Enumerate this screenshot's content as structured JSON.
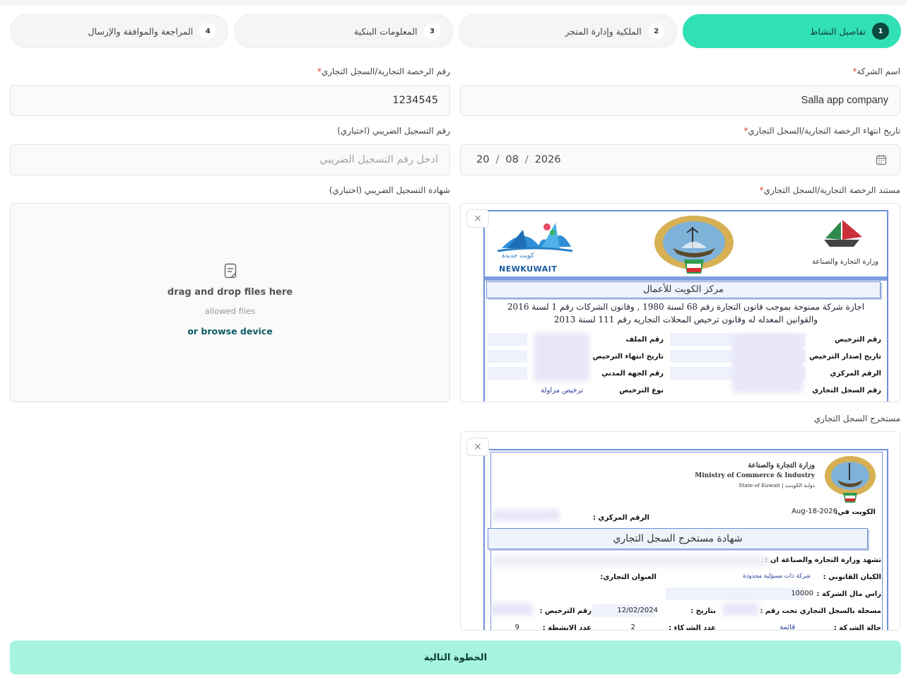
{
  "steps": [
    {
      "num": "1",
      "label": "تفاصيل النشاط"
    },
    {
      "num": "2",
      "label": "الملكية وإدارة المتجر"
    },
    {
      "num": "3",
      "label": "المعلومات البنكية"
    },
    {
      "num": "4",
      "label": "المراجعة والموافقة والإرسال"
    }
  ],
  "form": {
    "company_name_label": "اسم الشركة",
    "company_name_value": "Salla app company",
    "license_number_label": "رقم الرخصة التجارية/السجل التجاري",
    "license_number_value": "1234545",
    "license_expiry_label": "تاريخ انتهاء الرخصة التجارية/السجل التجاري",
    "license_expiry_day": "20",
    "license_expiry_month": "08",
    "license_expiry_year": "2026",
    "tax_number_label": "رقم التسجيل الضريبي (اختياري)",
    "tax_number_placeholder": "أدخل رقم التسجيل الضريبي",
    "license_doc_label": "مستند الرخصة التجارية/السجل التجاري",
    "tax_certificate_label": "شهادة التسجيل الضريبي (اختياري)",
    "commercial_extract_label": "مستخرج السجل التجاري",
    "required_mark": "*",
    "date_separator": "/"
  },
  "upload": {
    "drag_text": "drag and drop files here",
    "allowed_text": "allowed files",
    "browse_text": "or browse device",
    "close_glyph": "×"
  },
  "doc1": {
    "newkuwait": "NEWKUWAIT",
    "newkuwait_ar": "كويت جديدة",
    "ministry_ar": "وزارة التجارة والصناعة",
    "center_title": "مركز الكويت للأعمال",
    "line1": "اجازة شركة ممنوحة بموجب قانون التجارة رقم 68 لسنة 1980 , وقانون الشركات رقم 1 لسنة 2016",
    "line2": "والقوانين المعدله له وقانون ترخيص المحلات التجاريه رقم 111 لسنة 2013",
    "right_rows": [
      "رقم الترخيص",
      "تاريخ إصدار الترخيص",
      "الرقم المركزي",
      "رقم السجل التجاري"
    ],
    "mid_rows": [
      "رقم الملف",
      "تاريخ انتهاء الترخيص",
      "رقم الجهة المدني",
      "نوع الترخيص"
    ],
    "license_type_value": "ترخيص مزاولة"
  },
  "doc2": {
    "ministry_ar": "وزارة التجارة والصناعة",
    "ministry_en": "Ministry of Commerce & Industry",
    "state": "State of Kuwait | دولـة الكويـت",
    "kuwait_date_label": "الكويت في:",
    "kuwait_date_value": "2026-Aug-18",
    "central_number_label": "الرقم المركزي :",
    "title": "شهادة مستخرج السجل التجاري",
    "certify": "تشهد وزارة التجارة والصناعة ان :",
    "legal_entity_label": "الكيان القانوني :",
    "legal_entity_value": "شركة ذات مسؤلية محدودة",
    "address_label": "العنوان التجاري:",
    "capital_label": "راس مال الشركة :",
    "capital_value": "10000",
    "registered_label": "مسجلة بالسجل التجاري تحت رقم :",
    "date_label": "بتاريخ :",
    "date_value": "12/02/2024",
    "license_no_label": "رقم الترخيص :",
    "status_label": "حالة الشركة :",
    "status_value": "قائمة",
    "partners_label": "عدد الشركاء :",
    "partners_value": "2",
    "activities_label": "عدد الانشطة :",
    "activities_value": "9"
  },
  "next_button": "الخطوة التالية",
  "colors": {
    "active_step": "#32e0b6",
    "active_step_number": "#0b4a40",
    "next_button": "#a6f4e0",
    "required": "#e23b3b",
    "link": "#0c5c66"
  }
}
